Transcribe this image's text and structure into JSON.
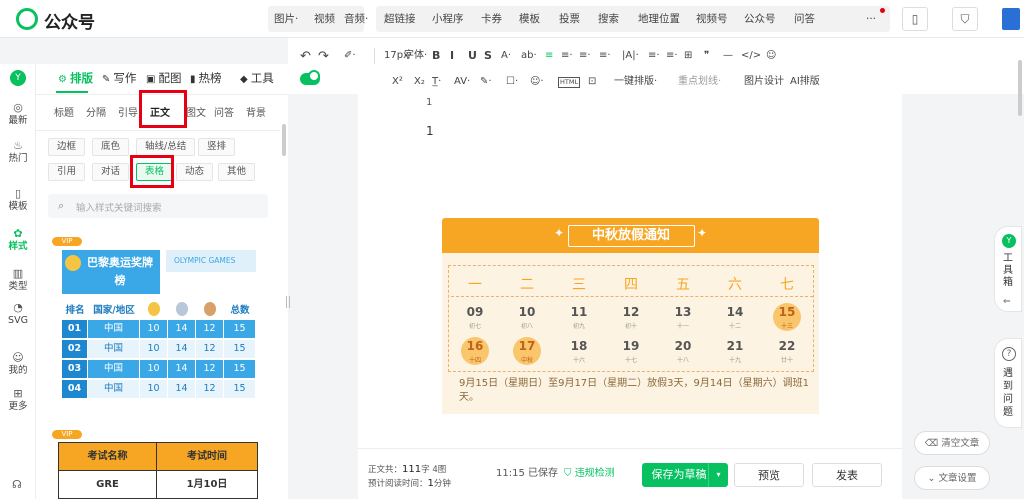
{
  "app": {
    "name": "公众号"
  },
  "topbar": {
    "groups": [
      {
        "items": [
          "图片·",
          "视频",
          "音频·"
        ]
      },
      {
        "items": [
          "超链接",
          "小程序",
          "卡券",
          "模板",
          "投票",
          "搜索",
          "地理位置",
          "视频号",
          "公众号",
          "问答",
          "···"
        ]
      }
    ]
  },
  "format_row1": [
    "17px·",
    "字体·",
    "B",
    "I",
    "U",
    "S",
    "A·",
    "ab·",
    "≡",
    "≡·",
    "≡·",
    "≡·",
    "|A|·",
    "≡·",
    "≡·",
    "⊞",
    "❞",
    "—",
    "</>",
    "☺"
  ],
  "format_row2": [
    "X²",
    "X₂",
    "T̲·",
    "AV·",
    "✎·",
    "☐·",
    "☺·",
    "HTML",
    "⊡",
    "一键排版·",
    "重点划线·",
    "图片设计",
    "AI排版"
  ],
  "rail": {
    "items": [
      {
        "label": "最新",
        "icon": "◎"
      },
      {
        "label": "热门",
        "icon": "♨"
      },
      {
        "label": "模板",
        "icon": "▯"
      },
      {
        "label": "样式",
        "icon": "✿",
        "active": true
      },
      {
        "label": "类型",
        "icon": "▥"
      },
      {
        "label": "SVG",
        "icon": "◔"
      },
      {
        "label": "我的",
        "icon": "☺"
      },
      {
        "label": "更多",
        "icon": "⊞"
      }
    ]
  },
  "panel": {
    "top_tabs": [
      "排版",
      "写作",
      "配图",
      "热榜",
      "工具"
    ],
    "sub_tabs": [
      "标题",
      "分隔",
      "引导",
      "正文",
      "图文",
      "问答",
      "背景"
    ],
    "chips_row1": [
      "边框",
      "底色",
      "轴线/总结",
      "竖排"
    ],
    "chips_row2": [
      "引用",
      "对话",
      "表格",
      "动态",
      "其他"
    ],
    "search_placeholder": "输入样式关键词搜索",
    "vip": "VIP",
    "olympic": {
      "title": "巴黎奥运奖牌榜",
      "brand": "OLYMPIC GAMES",
      "headers": [
        "排名",
        "国家/地区",
        "",
        "",
        "",
        "总数"
      ],
      "rows": [
        [
          "01",
          "中国",
          "10",
          "14",
          "12",
          "15"
        ],
        [
          "02",
          "中国",
          "10",
          "14",
          "12",
          "15"
        ],
        [
          "03",
          "中国",
          "10",
          "14",
          "12",
          "15"
        ],
        [
          "04",
          "中国",
          "10",
          "14",
          "12",
          "15"
        ]
      ]
    },
    "exam": {
      "headers": [
        "考试名称",
        "考试时间"
      ],
      "rows": [
        [
          "GRE",
          "1月10日"
        ]
      ]
    }
  },
  "editor": {
    "line1": "1",
    "line2": "1",
    "calendar": {
      "title": "中秋放假通知",
      "weekdays": [
        "一",
        "二",
        "三",
        "四",
        "五",
        "六",
        "七"
      ],
      "week1": [
        {
          "d": "09",
          "s": "初七"
        },
        {
          "d": "10",
          "s": "初八"
        },
        {
          "d": "11",
          "s": "初九"
        },
        {
          "d": "12",
          "s": "初十"
        },
        {
          "d": "13",
          "s": "十一"
        },
        {
          "d": "14",
          "s": "十二"
        },
        {
          "d": "15",
          "s": "十三",
          "holiday": true
        }
      ],
      "week2": [
        {
          "d": "16",
          "s": "十四",
          "holiday": true
        },
        {
          "d": "17",
          "s": "中秋",
          "holiday": true
        },
        {
          "d": "18",
          "s": "十六"
        },
        {
          "d": "19",
          "s": "十七"
        },
        {
          "d": "20",
          "s": "十八"
        },
        {
          "d": "21",
          "s": "十九"
        },
        {
          "d": "22",
          "s": "廿十"
        }
      ],
      "note": "9月15日（星期日）至9月17日（星期二）放假3天，9月14日（星期六）调班1天。"
    }
  },
  "footer": {
    "count_label": "正文共：",
    "count": "111",
    "count_unit": "字",
    "images": "4图",
    "read_label": "预计阅读时间：",
    "read": "1",
    "read_unit": "分钟",
    "saved_time": "11:15",
    "saved_text": "已保存",
    "check": "违规检测",
    "save_draft": "保存为草稿",
    "preview": "预览",
    "publish": "发表"
  },
  "side": {
    "toolbox": "工具箱",
    "help": "遇到问题",
    "clear": "清空文章",
    "settings": "文章设置"
  },
  "colors": {
    "accent": "#07c160",
    "calendar": "#f6a623",
    "table_blue": "#3aa7e6",
    "highlight": "#e60012"
  }
}
